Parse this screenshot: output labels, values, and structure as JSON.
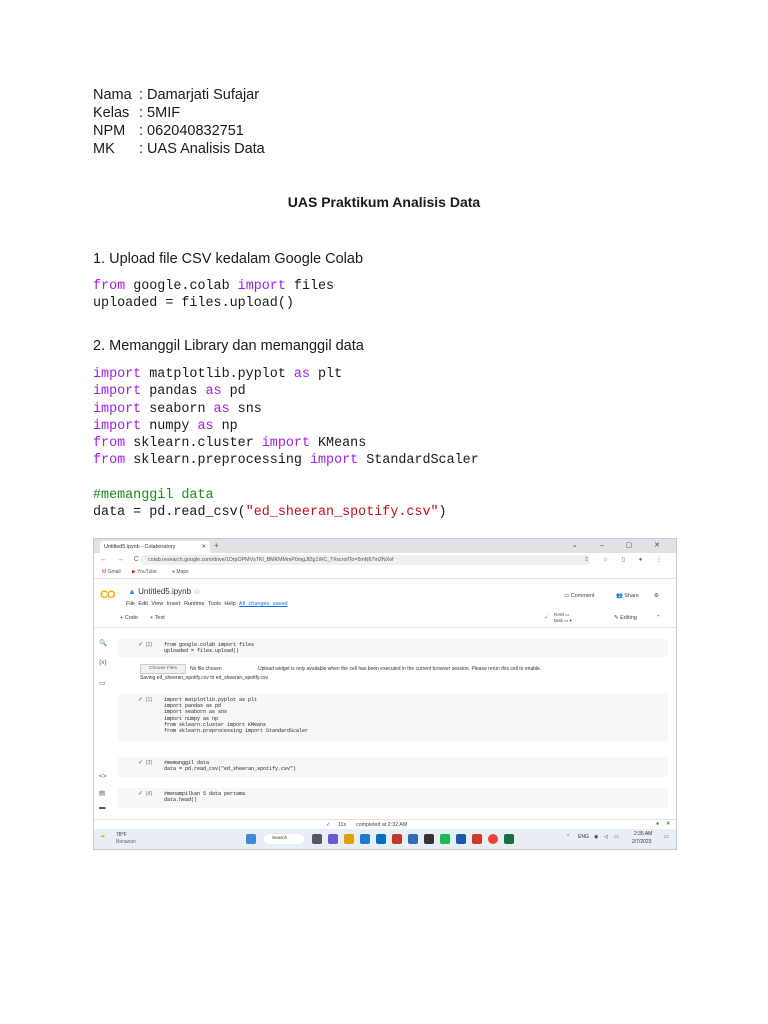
{
  "student": {
    "rows": [
      {
        "key": "Nama",
        "value": ": Damarjati Sufajar"
      },
      {
        "key": "Kelas",
        "value": ": 5MIF"
      },
      {
        "key": "NPM",
        "value": ": 062040832751"
      },
      {
        "key": "MK",
        "value": ": UAS Analisis Data"
      }
    ]
  },
  "title": "UAS Praktikum Analisis Data",
  "sections": {
    "s1": "1. Upload file CSV kedalam Google Colab",
    "s2": "2. Memanggil Library dan memanggil data"
  },
  "code1": {
    "l1": {
      "kw1": "from",
      "a": " google.colab ",
      "kw2": "import",
      "b": " files"
    },
    "l2": "uploaded = files.upload()"
  },
  "code2": {
    "l1": {
      "kw1": "import",
      "a": " matplotlib.pyplot ",
      "kw2": "as",
      "b": " plt"
    },
    "l2": {
      "kw1": "import",
      "a": " pandas ",
      "kw2": "as",
      "b": " pd"
    },
    "l3": {
      "kw1": "import",
      "a": " seaborn ",
      "kw2": "as",
      "b": " sns"
    },
    "l4": {
      "kw1": "import",
      "a": " numpy ",
      "kw2": "as",
      "b": " np"
    },
    "l5": {
      "kw1": "from",
      "a": " sklearn.cluster ",
      "kw2": "import",
      "b": " KMeans"
    },
    "l6": {
      "kw1": "from",
      "a": " sklearn.preprocessing ",
      "kw2": "import",
      "b": " StandardScaler"
    },
    "comment": "#memanggil data",
    "l8a": "data = pd.read_csv(",
    "l8s": "\"ed_sheeran_spotify.csv\"",
    "l8b": ")"
  },
  "screenshot": {
    "tab_title": "Untitled5.ipynb - Colaboratory",
    "tab_close": "✕",
    "new_tab": "+",
    "window_controls": "⌄ – ▢ ✕",
    "nav": "← → C",
    "url": "colab.research.google.com/drive/1DrpOPMVsTKl_BMKMMmP0mgJfZg1WC_T#scrollTo=5mN67m2NXef",
    "addr_icons": "⇪ ☆ ▯ ● ⋮",
    "bookmarks": [
      "Gmail",
      "YouTube",
      "Maps"
    ],
    "logo": "CO",
    "notebook_title": "Untitled5.ipynb",
    "menu": [
      "File",
      "Edit",
      "View",
      "Insert",
      "Runtime",
      "Tools",
      "Help"
    ],
    "saved": "All changes saved",
    "comment": "Comment",
    "share": "Share",
    "add_code": "+ Code",
    "add_text": "+ Text",
    "ram": "RAM",
    "disk": "Disk",
    "editing": "Editing",
    "cells": [
      {
        "num": "[2]",
        "code": "from google.colab import files\nuploaded = files.upload()"
      },
      {
        "num": "[1]",
        "code": "import matplotlib.pyplot as plt\nimport pandas as pd\nimport seaborn as sns\nimport numpy as np\nfrom sklearn.cluster import KMeans\nfrom sklearn.preprocessing import StandardScaler"
      },
      {
        "num": "[3]",
        "code": "#memanggil data\ndata = pd.read_csv(\"ed_sheeran_spotify.csv\")"
      },
      {
        "num": "[4]",
        "code": "#menampilkan 5 data pertama\ndata.head()"
      }
    ],
    "choose_files": "Choose Files",
    "no_file": "No file chosen",
    "upload_msg": "Upload widget is only available when the cell has been executed in the current browser session. Please rerun this cell to enable.",
    "saving": "Saving ed_sheeran_spotify.csv to ed_sheeran_spotify.csv",
    "status_time": "11s",
    "status_text": "completed at 2:32 AM",
    "weather_temp": "78°F",
    "weather_desc": "Berawan",
    "search": "Search",
    "lang": "ENG",
    "clock_time": "2:35 AM",
    "clock_date": "2/7/2023"
  }
}
